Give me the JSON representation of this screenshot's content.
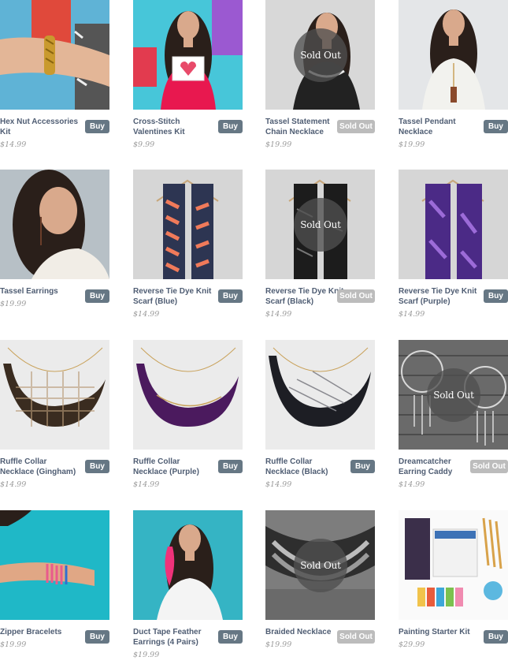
{
  "icons": {
    "product": "product-photo",
    "badge": "sold-out-badge"
  },
  "colors": {
    "buy_button": "#667784",
    "sold_out_button": "#bcbcbc",
    "product_name": "#4f5d73",
    "price": "#9a9a9a"
  },
  "products": [
    {
      "name": "Hex Nut Accessories Kit",
      "price": "$14.99",
      "button": "Buy",
      "sold_out": false,
      "badge": "",
      "photo": "bracelet"
    },
    {
      "name": "Cross-Stitch Valentines Kit",
      "price": "$9.99",
      "button": "Buy",
      "sold_out": false,
      "badge": "",
      "photo": "woman-card"
    },
    {
      "name": "Tassel Statement Chain Necklace",
      "price": "$19.99",
      "button": "Sold Out",
      "sold_out": true,
      "badge": "Sold Out",
      "photo": "woman-bw"
    },
    {
      "name": "Tassel Pendant Necklace",
      "price": "$19.99",
      "button": "Buy",
      "sold_out": false,
      "badge": "",
      "photo": "woman-white"
    },
    {
      "name": "Tassel Earrings",
      "price": "$19.99",
      "button": "Buy",
      "sold_out": false,
      "badge": "",
      "photo": "woman-earring"
    },
    {
      "name": "Reverse Tie Dye Knit Scarf (Blue)",
      "price": "$14.99",
      "button": "Buy",
      "sold_out": false,
      "badge": "",
      "photo": "scarf-blue"
    },
    {
      "name": "Reverse Tie Dye Knit Scarf (Black)",
      "price": "$14.99",
      "button": "Sold Out",
      "sold_out": true,
      "badge": "Sold Out",
      "photo": "scarf-black"
    },
    {
      "name": "Reverse Tie Dye Knit Scarf (Purple)",
      "price": "$14.99",
      "button": "Buy",
      "sold_out": false,
      "badge": "",
      "photo": "scarf-purple"
    },
    {
      "name": "Ruffle Collar Necklace (Gingham)",
      "price": "$14.99",
      "button": "Buy",
      "sold_out": false,
      "badge": "",
      "photo": "ruffle-gingham"
    },
    {
      "name": "Ruffle Collar Necklace (Purple)",
      "price": "$14.99",
      "button": "Buy",
      "sold_out": false,
      "badge": "",
      "photo": "ruffle-purple"
    },
    {
      "name": "Ruffle Collar Necklace (Black)",
      "price": "$14.99",
      "button": "Buy",
      "sold_out": false,
      "badge": "",
      "photo": "ruffle-black"
    },
    {
      "name": "Dreamcatcher Earring Caddy",
      "price": "$14.99",
      "button": "Sold Out",
      "sold_out": true,
      "badge": "Sold Out",
      "photo": "dreamcatcher"
    },
    {
      "name": "Zipper Bracelets",
      "price": "$19.99",
      "button": "Buy",
      "sold_out": false,
      "badge": "",
      "photo": "zipper"
    },
    {
      "name": "Duct Tape Feather Earrings (4 Pairs)",
      "price": "$19.99",
      "button": "Buy",
      "sold_out": false,
      "badge": "",
      "photo": "woman-feather"
    },
    {
      "name": "Braided Necklace",
      "price": "$19.99",
      "button": "Sold Out",
      "sold_out": true,
      "badge": "Sold Out",
      "photo": "braided"
    },
    {
      "name": "Painting Starter Kit",
      "price": "$29.99",
      "button": "Buy",
      "sold_out": false,
      "badge": "",
      "photo": "paint-kit"
    }
  ]
}
